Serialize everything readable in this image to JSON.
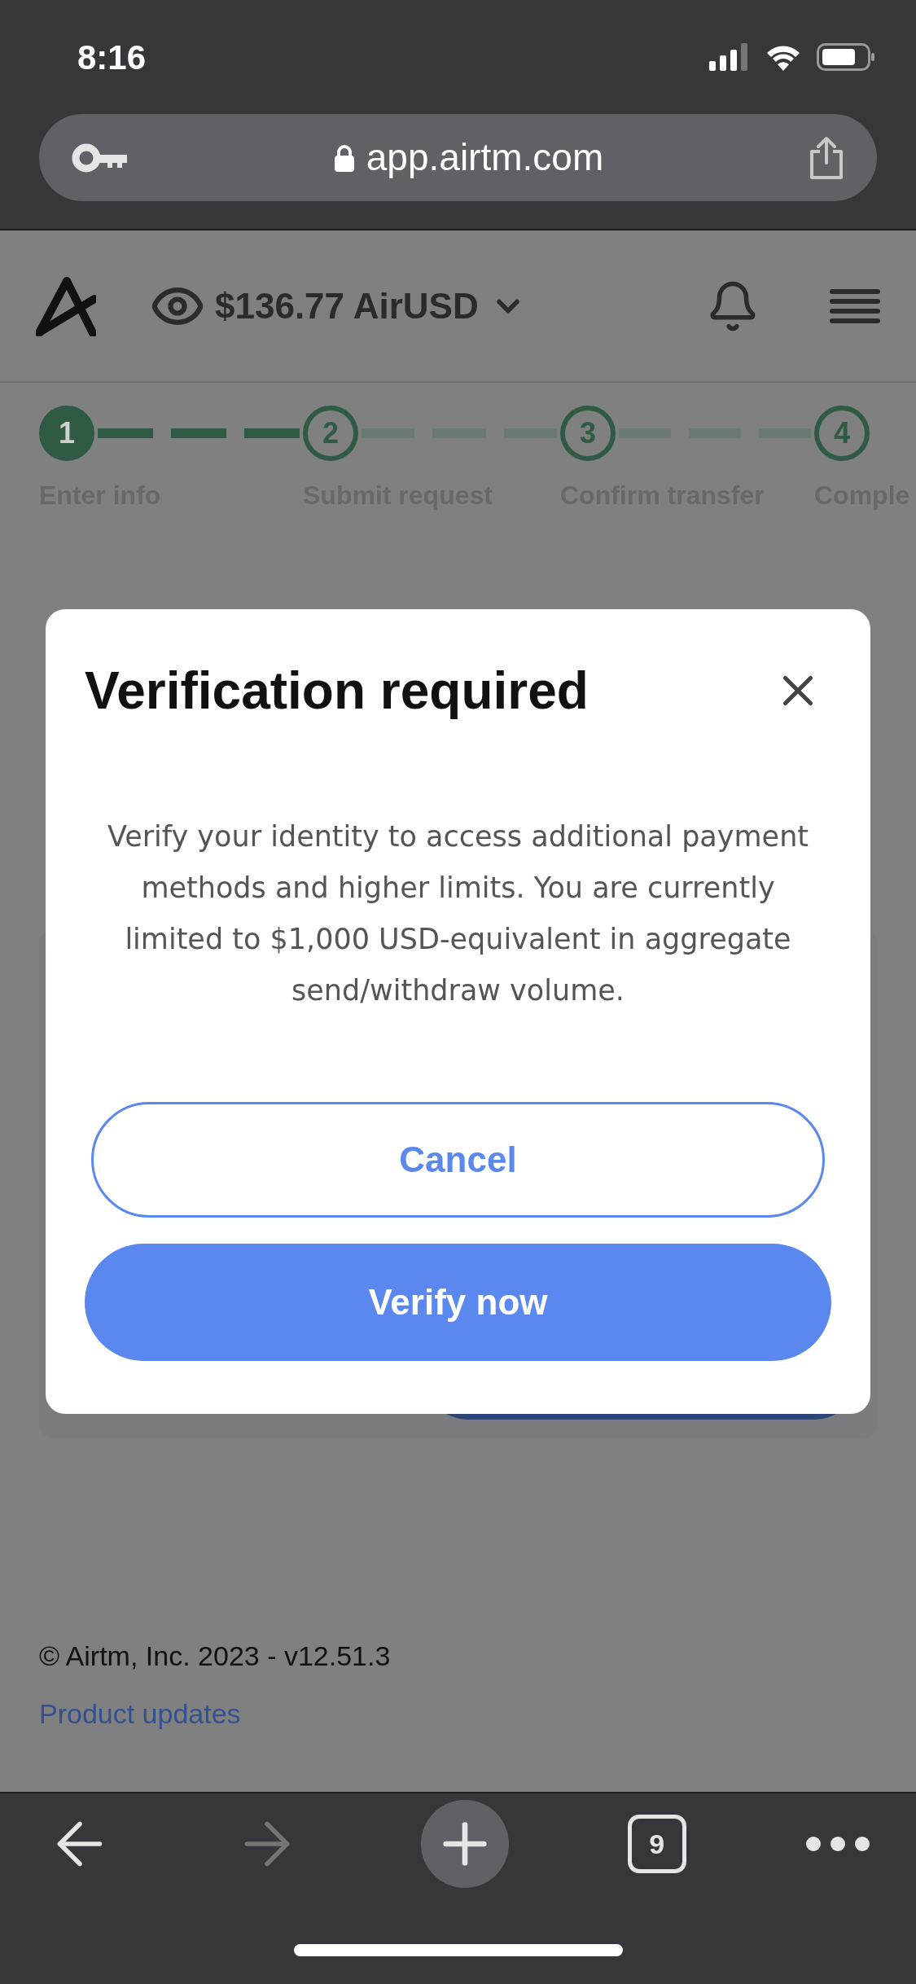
{
  "status_bar": {
    "time": "8:16"
  },
  "browser": {
    "url": "app.airtm.com",
    "tab_count": "9",
    "forward_disabled": true
  },
  "header": {
    "balance": "$136.77 AirUSD"
  },
  "steps": [
    {
      "number": "1",
      "label": "Enter info",
      "selected": true
    },
    {
      "number": "2",
      "label": "Submit request",
      "selected": false
    },
    {
      "number": "3",
      "label": "Confirm transfer",
      "selected": false
    },
    {
      "number": "4",
      "label": "Comple",
      "selected": false
    }
  ],
  "modal": {
    "title": "Verification required",
    "message": "Verify your identity to access additional payment methods and higher limits. You are currently limited to $1,000 USD-equivalent in aggregate send/withdraw volume.",
    "buttons": [
      {
        "label": "Cancel",
        "kind": "outline"
      },
      {
        "label": "Verify now",
        "kind": "primary"
      }
    ]
  },
  "footer": {
    "copyright": "© Airtm, Inc. 2023 - v12.51.3",
    "link": "Product updates"
  }
}
